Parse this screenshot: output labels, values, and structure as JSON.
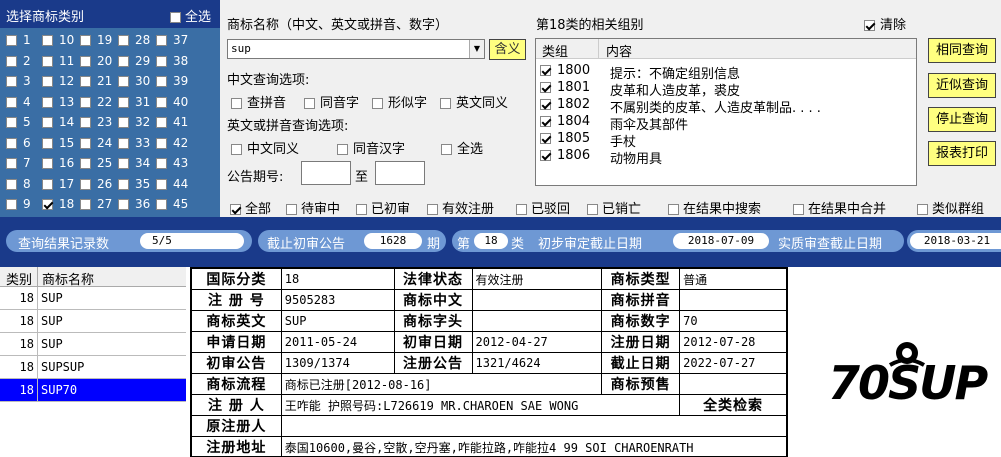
{
  "class_panel": {
    "title": "选择商标类别",
    "select_all": "全选",
    "classes": [
      {
        "n": "1",
        "checked": false
      },
      {
        "n": "10",
        "checked": false
      },
      {
        "n": "19",
        "checked": false
      },
      {
        "n": "28",
        "checked": false
      },
      {
        "n": "37",
        "checked": false
      },
      {
        "n": "2",
        "checked": false
      },
      {
        "n": "11",
        "checked": false
      },
      {
        "n": "20",
        "checked": false
      },
      {
        "n": "29",
        "checked": false
      },
      {
        "n": "38",
        "checked": false
      },
      {
        "n": "3",
        "checked": false
      },
      {
        "n": "12",
        "checked": false
      },
      {
        "n": "21",
        "checked": false
      },
      {
        "n": "30",
        "checked": false
      },
      {
        "n": "39",
        "checked": false
      },
      {
        "n": "4",
        "checked": false
      },
      {
        "n": "13",
        "checked": false
      },
      {
        "n": "22",
        "checked": false
      },
      {
        "n": "31",
        "checked": false
      },
      {
        "n": "40",
        "checked": false
      },
      {
        "n": "5",
        "checked": false
      },
      {
        "n": "14",
        "checked": false
      },
      {
        "n": "23",
        "checked": false
      },
      {
        "n": "32",
        "checked": false
      },
      {
        "n": "41",
        "checked": false
      },
      {
        "n": "6",
        "checked": false
      },
      {
        "n": "15",
        "checked": false
      },
      {
        "n": "24",
        "checked": false
      },
      {
        "n": "33",
        "checked": false
      },
      {
        "n": "42",
        "checked": false
      },
      {
        "n": "7",
        "checked": false
      },
      {
        "n": "16",
        "checked": false
      },
      {
        "n": "25",
        "checked": false
      },
      {
        "n": "34",
        "checked": false
      },
      {
        "n": "43",
        "checked": false
      },
      {
        "n": "8",
        "checked": false
      },
      {
        "n": "17",
        "checked": false
      },
      {
        "n": "26",
        "checked": false
      },
      {
        "n": "35",
        "checked": false
      },
      {
        "n": "44",
        "checked": false
      },
      {
        "n": "9",
        "checked": false
      },
      {
        "n": "18",
        "checked": true
      },
      {
        "n": "27",
        "checked": false
      },
      {
        "n": "36",
        "checked": false
      },
      {
        "n": "45",
        "checked": false
      }
    ]
  },
  "search": {
    "name_label": "商标名称（中文、英文或拼音、数字）",
    "name_value": "sup",
    "meaning_button": "含义",
    "cn_options_label": "中文查询选项:",
    "cn_options": [
      "查拼音",
      "同音字",
      "形似字",
      "英文同义"
    ],
    "en_options_label": "英文或拼音查询选项:",
    "en_options": [
      "中文同义",
      "同音汉字",
      "全选"
    ],
    "issue_label": "公告期号:",
    "issue_to": "至"
  },
  "groups": {
    "title": "第18类的相关组别",
    "clear_label": "清除",
    "col_group": "类组",
    "col_content": "内容",
    "rows": [
      {
        "code": "1800",
        "text": "提示：不确定组别信息"
      },
      {
        "code": "1801",
        "text": "皮革和人造皮革，裘皮"
      },
      {
        "code": "1802",
        "text": "不属别类的皮革、人造皮革制品. . . ."
      },
      {
        "code": "1804",
        "text": "雨伞及其部件"
      },
      {
        "code": "1805",
        "text": "手杖"
      },
      {
        "code": "1806",
        "text": "动物用具"
      }
    ]
  },
  "buttons": [
    "相同查询",
    "近似查询",
    "停止查询",
    "报表打印"
  ],
  "filters": [
    {
      "label": "全部",
      "checked": true
    },
    {
      "label": "待审中",
      "checked": false
    },
    {
      "label": "已初审",
      "checked": false
    },
    {
      "label": "有效注册",
      "checked": false
    },
    {
      "label": "已驳回",
      "checked": false
    },
    {
      "label": "已销亡",
      "checked": false
    },
    {
      "label": "在结果中搜索",
      "checked": false
    },
    {
      "label": "在结果中合并",
      "checked": false
    },
    {
      "label": "类似群组",
      "checked": false
    }
  ],
  "status": {
    "records_label": "查询结果记录数",
    "records_value": "5/5",
    "cutoff_label": "截止初审公告",
    "cutoff_value": "1628",
    "cutoff_unit": "期",
    "class_prefix": "第",
    "class_value": "18",
    "class_suffix": "类",
    "initial_label": "初步审定截止日期",
    "initial_value": "2018-07-09",
    "substantive_label": "实质审查截止日期",
    "substantive_value": "2018-03-21"
  },
  "results": {
    "col_class": "类别",
    "col_name": "商标名称",
    "rows": [
      {
        "cls": "18",
        "name": "SUP",
        "selected": false
      },
      {
        "cls": "18",
        "name": "SUP",
        "selected": false
      },
      {
        "cls": "18",
        "name": "SUP",
        "selected": false
      },
      {
        "cls": "18",
        "name": "SUPSUP",
        "selected": false
      },
      {
        "cls": "18",
        "name": "SUP70",
        "selected": true
      }
    ]
  },
  "detail": {
    "intl_class_k": "国际分类",
    "intl_class_v": "18",
    "legal_status_k": "法律状态",
    "legal_status_v": "有效注册",
    "type_k": "商标类型",
    "type_v": "普通",
    "reg_no_k": "注 册 号",
    "reg_no_v": "9505283",
    "cn_name_k": "商标中文",
    "cn_name_v": "",
    "pinyin_k": "商标拼音",
    "pinyin_v": "",
    "en_name_k": "商标英文",
    "en_name_v": "SUP",
    "initial_k": "商标字头",
    "initial_v": "",
    "digits_k": "商标数字",
    "digits_v": "70",
    "apply_date_k": "申请日期",
    "apply_date_v": "2011-05-24",
    "prelim_date_k": "初审日期",
    "prelim_date_v": "2012-04-27",
    "reg_date_k": "注册日期",
    "reg_date_v": "2012-07-28",
    "prelim_pub_k": "初审公告",
    "prelim_pub_v": "1309/1374",
    "reg_pub_k": "注册公告",
    "reg_pub_v": "1321/4624",
    "expiry_k": "截止日期",
    "expiry_v": "2022-07-27",
    "flow_k": "商标流程",
    "flow_v": "商标已注册[2012-08-16]",
    "forecast_k": "商标预售",
    "forecast_v": "",
    "registrant_k": "注 册 人",
    "registrant_v": "王咋能 护照号码:L726619 MR.CHAROEN SAE WONG",
    "all_class_search": "全类检索",
    "orig_registrant_k": "原注册人",
    "orig_registrant_v": "",
    "address_k": "注册地址",
    "address_v": "泰国10600,曼谷,空散,空丹塞,咋能拉路,咋能拉4 99 SOI CHAROENRATH"
  },
  "logo": {
    "text": "70SUP"
  }
}
